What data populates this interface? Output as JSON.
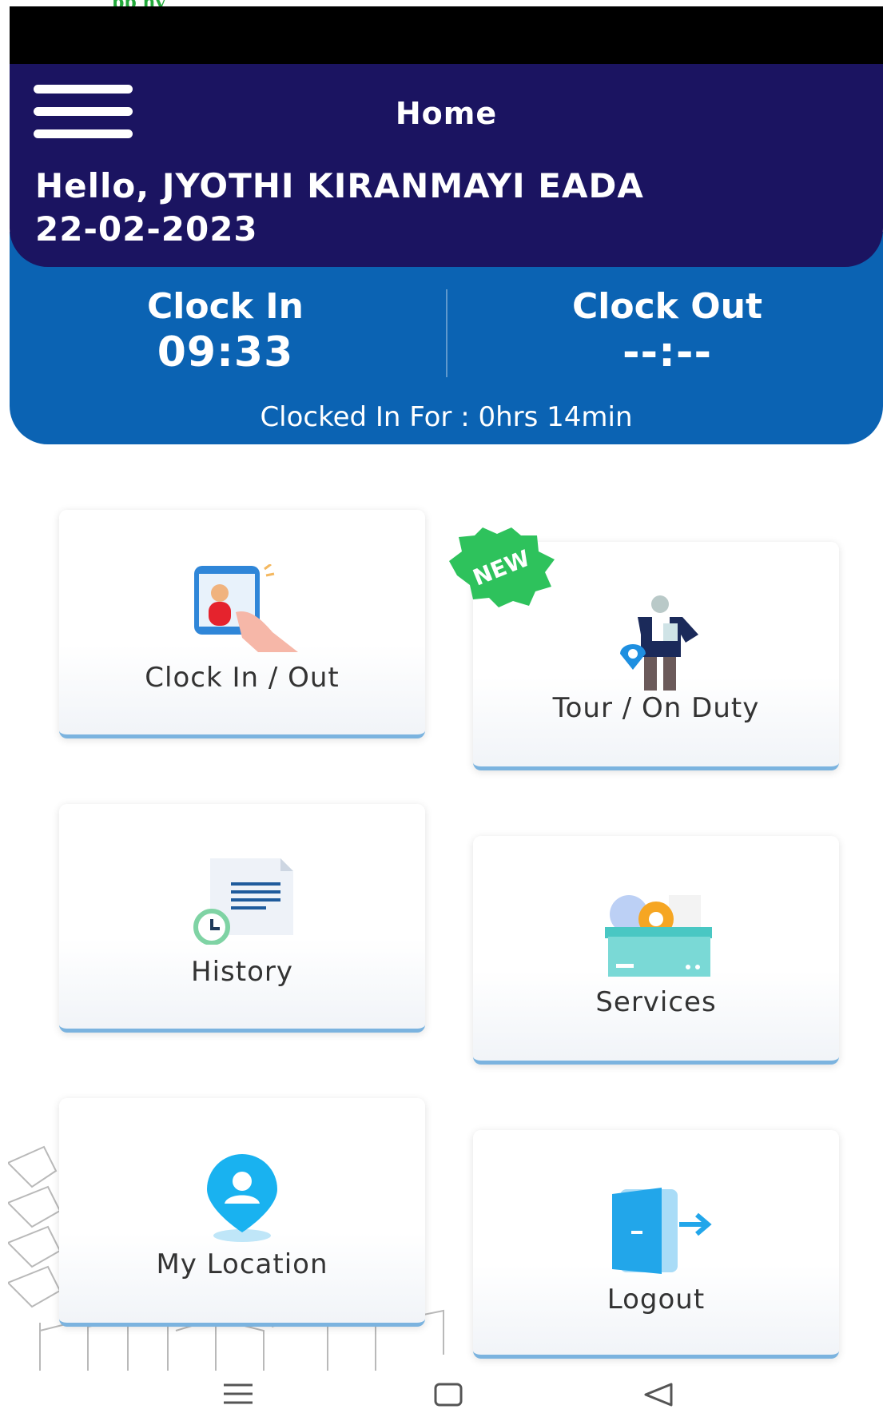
{
  "header": {
    "title": "Home",
    "greeting": "Hello, JYOTHI KIRANMAYI EADA",
    "date": "22-02-2023"
  },
  "clock": {
    "in_label": "Clock In",
    "in_value": "09:33",
    "out_label": "Clock Out",
    "out_value": "--:--",
    "duration_text": "Clocked In For : 0hrs 14min"
  },
  "tiles": {
    "clock_in_out": "Clock In / Out",
    "tour_on_duty": "Tour / On Duty",
    "history": "History",
    "services": "Services",
    "my_location": "My Location",
    "logout": "Logout"
  },
  "badge": {
    "new": "NEW"
  },
  "icons": {
    "menu": "hamburger-menu-icon",
    "nav_recents": "recents-icon",
    "nav_home": "home-square-icon",
    "nav_back": "back-triangle-icon"
  },
  "colors": {
    "header_bg": "#1b1461",
    "clock_bg": "#0b63b3",
    "badge": "#2ec25c",
    "card_accent": "#7bb3df"
  }
}
